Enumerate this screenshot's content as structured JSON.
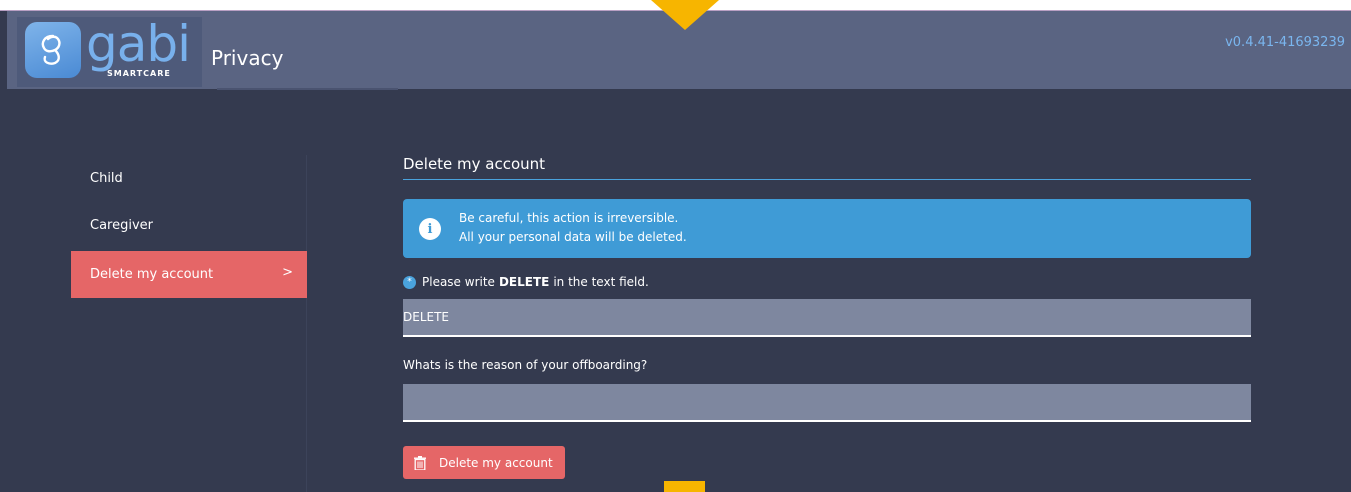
{
  "app": {
    "logo_text": "gabi",
    "logo_subtext": "SMARTCARE",
    "page_title": "Privacy",
    "version": "v0.4.41-41693239"
  },
  "sidebar": {
    "items": [
      {
        "label": "Child"
      },
      {
        "label": "Caregiver"
      },
      {
        "label": "Delete my account",
        "chevron": ">",
        "active": true
      }
    ]
  },
  "main": {
    "section_title": "Delete my account",
    "alert": {
      "icon": "info-icon",
      "line1": "Be careful, this action is irreversible.",
      "line2": "All your personal data will be deleted."
    },
    "confirm": {
      "label_prefix": "Please write",
      "label_keyword": "DELETE",
      "label_suffix": "in the text field.",
      "value": "DELETE"
    },
    "reason": {
      "label": "Whats is the reason of your offboarding?",
      "value": ""
    },
    "delete_button": {
      "label": "Delete my account",
      "icon": "trash-icon"
    }
  },
  "colors": {
    "header": "#5a6482",
    "background": "#343a4f",
    "accent_blue": "#3f9bd6",
    "danger": "#e56667",
    "marker": "#f7b500",
    "field": "#7e879f"
  }
}
